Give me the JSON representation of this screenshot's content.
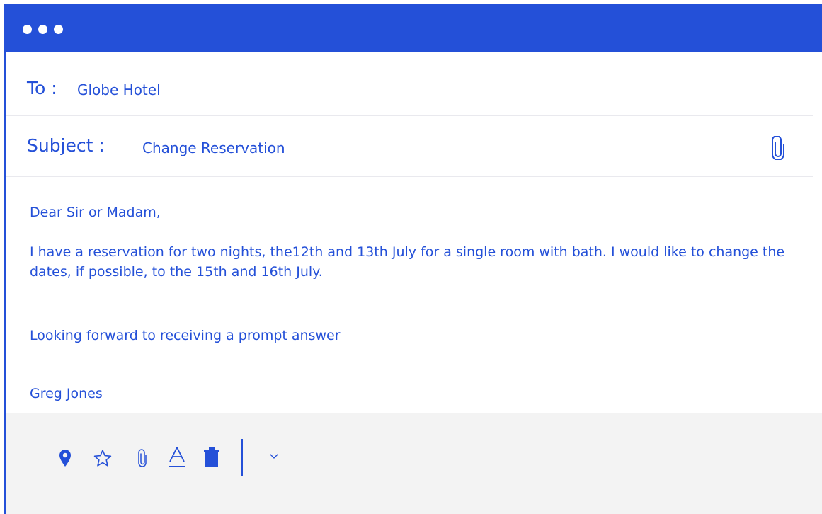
{
  "header": {
    "window_controls": [
      "dot",
      "dot",
      "dot"
    ]
  },
  "to": {
    "label": "To :",
    "value": "Globe Hotel"
  },
  "subject": {
    "label": "Subject :",
    "value": "Change Reservation",
    "attach_icon": "paperclip-icon"
  },
  "body": {
    "greeting": "Dear Sir or Madam,",
    "main": "I have a reservation for two nights, the12th and 13th July for a single room with bath. I would like to change the dates, if possible, to the 15th and 16th July.",
    "closing": "Looking forward to receiving a prompt answer",
    "signature": "Greg Jones"
  },
  "toolbar": {
    "icons": [
      "location-pin-icon",
      "star-icon",
      "paperclip-icon",
      "text-format-icon",
      "trash-icon",
      "chevron-down-icon"
    ]
  },
  "colors": {
    "accent": "#2450d8",
    "toolbar_bg": "#f3f3f3",
    "divider": "#e9e9ee"
  }
}
